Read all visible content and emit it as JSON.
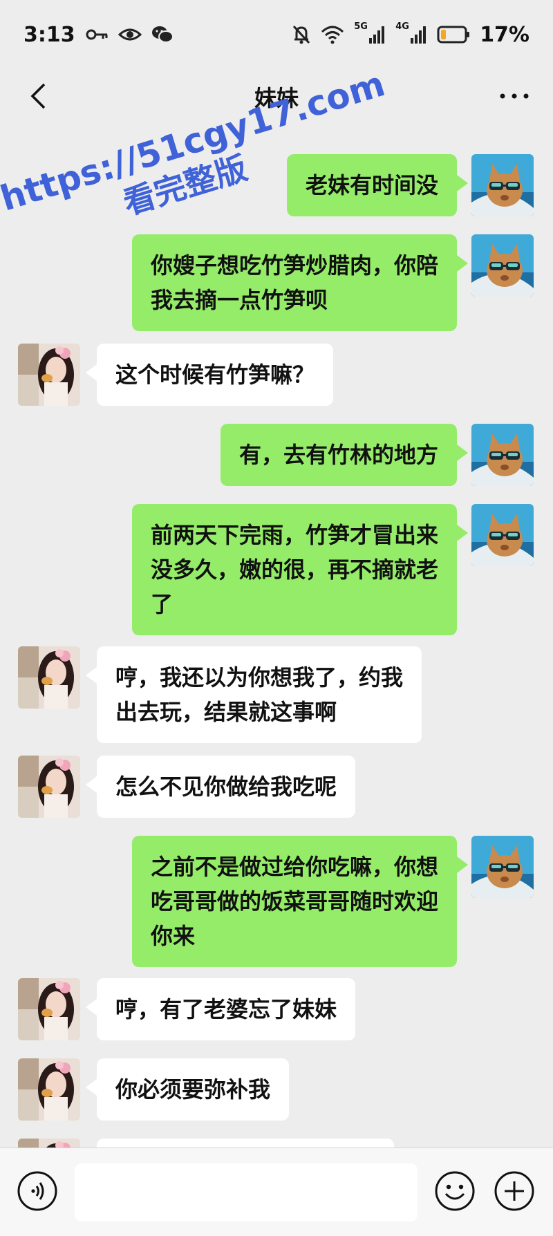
{
  "status_bar": {
    "time": "3:13",
    "network_5g_label": "5G",
    "network_4g_label": "4G",
    "battery_percent": "17%",
    "icons": [
      "key-icon",
      "eye-icon",
      "wechat-icon",
      "mute-bell-icon",
      "wifi-icon",
      "signal-icon",
      "battery-icon"
    ]
  },
  "header": {
    "title": "妹妹",
    "back_icon": "chevron-left-icon",
    "more_icon": "more-dots-icon"
  },
  "watermark": {
    "line1": "https://51cgy17.com",
    "line2": "看完整版"
  },
  "messages": [
    {
      "side": "sent",
      "text": "老妹有时间没"
    },
    {
      "side": "sent",
      "text": "你嫂子想吃竹笋炒腊肉，你陪\n我去摘一点竹笋呗"
    },
    {
      "side": "received",
      "text": "这个时候有竹笋嘛？"
    },
    {
      "side": "sent",
      "text": "有，去有竹林的地方"
    },
    {
      "side": "sent",
      "text": "前两天下完雨，竹笋才冒出来\n没多久，嫩的很，再不摘就老\n了"
    },
    {
      "side": "received",
      "text": "哼，我还以为你想我了，约我\n出去玩，结果就这事啊"
    },
    {
      "side": "received",
      "text": "怎么不见你做给我吃呢"
    },
    {
      "side": "sent",
      "text": "之前不是做过给你吃嘛，你想\n吃哥哥做的饭菜哥哥随时欢迎\n你来"
    },
    {
      "side": "received",
      "text": "哼，有了老婆忘了妹妹"
    },
    {
      "side": "received",
      "text": "你必须要弥补我"
    },
    {
      "side": "received",
      "text": ""
    }
  ],
  "input_bar": {
    "value": "",
    "voice_icon": "voice-icon",
    "emoji_icon": "emoji-icon",
    "plus_icon": "plus-icon"
  },
  "colors": {
    "background": "#ededed",
    "sent_bubble": "#95ec69",
    "received_bubble": "#ffffff",
    "watermark": "#4062d8",
    "battery_low": "#f5a623"
  }
}
